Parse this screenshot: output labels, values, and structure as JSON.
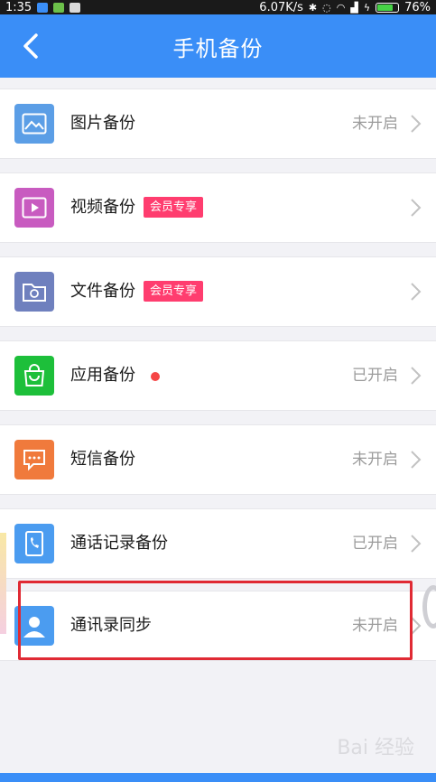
{
  "status_bar": {
    "time": "1:35",
    "network_speed": "6.07K/s",
    "battery": "76%",
    "battery_level": 0.76
  },
  "header": {
    "title": "手机备份",
    "back_icon": "chevron-left-icon"
  },
  "colors": {
    "header_bg": "#3a8ef7",
    "badge_bg": "#ff3d6f",
    "highlight_border": "#e02a34"
  },
  "items": [
    {
      "label": "图片备份",
      "status": "未开启",
      "icon": "image-icon",
      "icon_color": "#5b9ee6"
    },
    {
      "label": "视频备份",
      "badge": "会员专享",
      "icon": "video-icon",
      "icon_color": "#c85bc0"
    },
    {
      "label": "文件备份",
      "badge": "会员专享",
      "icon": "folder-sync-icon",
      "icon_color": "#6f80be"
    },
    {
      "label": "应用备份",
      "status": "已开启",
      "icon": "shopping-bag-icon",
      "icon_color": "#1dbf3a",
      "has_dot": true
    },
    {
      "label": "短信备份",
      "status": "未开启",
      "icon": "message-icon",
      "icon_color": "#f07a3c"
    },
    {
      "label": "通话记录备份",
      "status": "已开启",
      "icon": "call-log-icon",
      "icon_color": "#4b9cf0"
    },
    {
      "label": "通讯录同步",
      "status": "未开启",
      "icon": "contact-icon",
      "icon_color": "#4b9cf0"
    }
  ],
  "watermark": "Bai 经验"
}
